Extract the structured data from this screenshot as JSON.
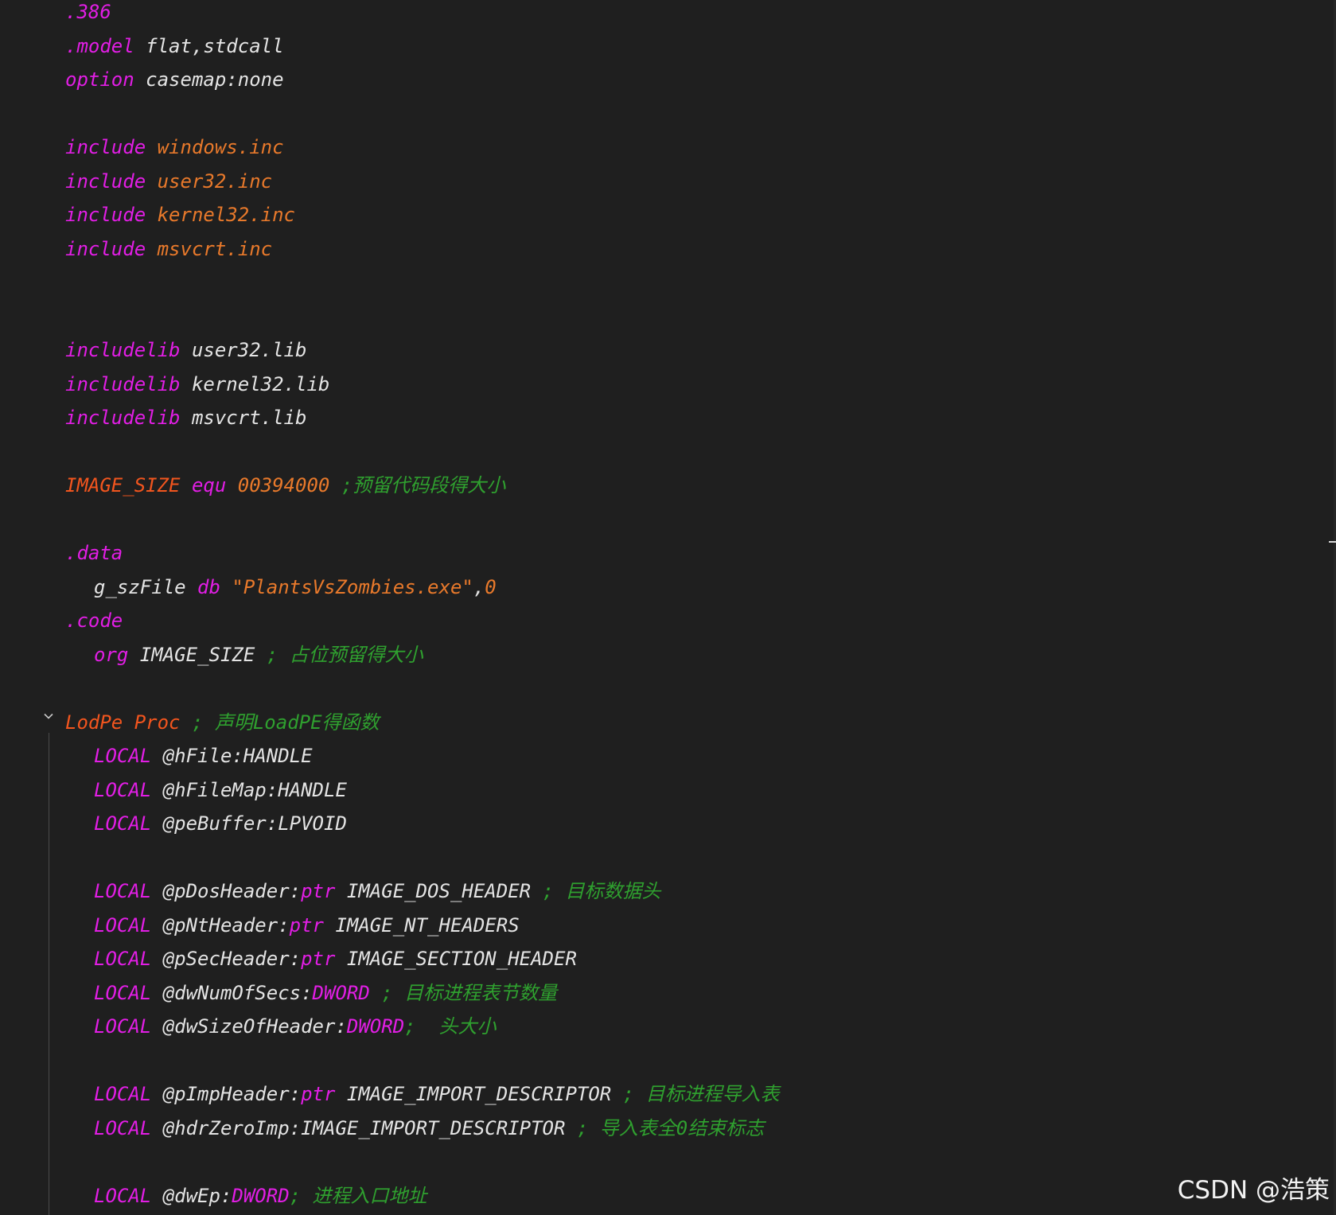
{
  "editor": {
    "colors": {
      "background": "#1f1f1f",
      "keyword": "#e21ee5",
      "string_orange": "#e8792b",
      "identifier_red": "#f2551e",
      "plain": "#e4e4e4",
      "comment": "#2fa02f"
    },
    "lines": [
      {
        "indent": 0,
        "tokens": [
          {
            "t": ".386",
            "c": "kw"
          }
        ]
      },
      {
        "indent": 0,
        "tokens": [
          {
            "t": ".model",
            "c": "kw"
          },
          {
            "t": " flat,stdcall",
            "c": "plain"
          }
        ]
      },
      {
        "indent": 0,
        "tokens": [
          {
            "t": "option",
            "c": "kw"
          },
          {
            "t": " casemap:none",
            "c": "plain"
          }
        ]
      },
      {
        "indent": 0,
        "tokens": []
      },
      {
        "indent": 0,
        "tokens": [
          {
            "t": "include",
            "c": "kw"
          },
          {
            "t": " windows.inc",
            "c": "orange"
          }
        ]
      },
      {
        "indent": 0,
        "tokens": [
          {
            "t": "include",
            "c": "kw"
          },
          {
            "t": " user32.inc",
            "c": "orange"
          }
        ]
      },
      {
        "indent": 0,
        "tokens": [
          {
            "t": "include",
            "c": "kw"
          },
          {
            "t": " kernel32.inc",
            "c": "orange"
          }
        ]
      },
      {
        "indent": 0,
        "tokens": [
          {
            "t": "include",
            "c": "kw"
          },
          {
            "t": " msvcrt.inc",
            "c": "orange"
          }
        ]
      },
      {
        "indent": 0,
        "tokens": []
      },
      {
        "indent": 0,
        "tokens": []
      },
      {
        "indent": 0,
        "tokens": [
          {
            "t": "includelib",
            "c": "kw"
          },
          {
            "t": " user32.lib",
            "c": "plain"
          }
        ]
      },
      {
        "indent": 0,
        "tokens": [
          {
            "t": "includelib",
            "c": "kw"
          },
          {
            "t": " kernel32.lib",
            "c": "plain"
          }
        ]
      },
      {
        "indent": 0,
        "tokens": [
          {
            "t": "includelib",
            "c": "kw"
          },
          {
            "t": " msvcrt.lib",
            "c": "plain"
          }
        ]
      },
      {
        "indent": 0,
        "tokens": []
      },
      {
        "indent": 0,
        "tokens": [
          {
            "t": "IMAGE_SIZE",
            "c": "red"
          },
          {
            "t": " equ",
            "c": "kw"
          },
          {
            "t": " 00394000",
            "c": "orange"
          },
          {
            "t": " ;预留代码段得大小",
            "c": "comment"
          }
        ]
      },
      {
        "indent": 0,
        "tokens": []
      },
      {
        "indent": 0,
        "tokens": [
          {
            "t": ".data",
            "c": "kw"
          }
        ]
      },
      {
        "indent": 1,
        "tokens": [
          {
            "t": "g_szFile",
            "c": "plain"
          },
          {
            "t": " db",
            "c": "kw"
          },
          {
            "t": " \"PlantsVsZombies.exe\"",
            "c": "orange"
          },
          {
            "t": ",",
            "c": "plain"
          },
          {
            "t": "0",
            "c": "orange"
          }
        ]
      },
      {
        "indent": 0,
        "tokens": [
          {
            "t": ".code",
            "c": "kw"
          }
        ]
      },
      {
        "indent": 1,
        "tokens": [
          {
            "t": "org",
            "c": "kw"
          },
          {
            "t": " IMAGE_SIZE",
            "c": "plain"
          },
          {
            "t": " ; 占位预留得大小",
            "c": "comment"
          }
        ]
      },
      {
        "indent": 0,
        "tokens": []
      },
      {
        "indent": 0,
        "tokens": [
          {
            "t": "LodPe",
            "c": "red"
          },
          {
            "t": " Proc",
            "c": "red"
          },
          {
            "t": " ; 声明LoadPE得函数",
            "c": "comment"
          }
        ]
      },
      {
        "indent": 1,
        "tokens": [
          {
            "t": "LOCAL",
            "c": "kw"
          },
          {
            "t": " @hFile:HANDLE",
            "c": "plain"
          }
        ]
      },
      {
        "indent": 1,
        "tokens": [
          {
            "t": "LOCAL",
            "c": "kw"
          },
          {
            "t": " @hFileMap:HANDLE",
            "c": "plain"
          }
        ]
      },
      {
        "indent": 1,
        "tokens": [
          {
            "t": "LOCAL",
            "c": "kw"
          },
          {
            "t": " @peBuffer:LPVOID",
            "c": "plain"
          }
        ]
      },
      {
        "indent": 0,
        "tokens": []
      },
      {
        "indent": 1,
        "tokens": [
          {
            "t": "LOCAL",
            "c": "kw"
          },
          {
            "t": " @pDosHeader:",
            "c": "plain"
          },
          {
            "t": "ptr",
            "c": "kw"
          },
          {
            "t": " IMAGE_DOS_HEADER",
            "c": "plain"
          },
          {
            "t": " ; 目标数据头",
            "c": "comment"
          }
        ]
      },
      {
        "indent": 1,
        "tokens": [
          {
            "t": "LOCAL",
            "c": "kw"
          },
          {
            "t": " @pNtHeader:",
            "c": "plain"
          },
          {
            "t": "ptr",
            "c": "kw"
          },
          {
            "t": " IMAGE_NT_HEADERS",
            "c": "plain"
          }
        ]
      },
      {
        "indent": 1,
        "tokens": [
          {
            "t": "LOCAL",
            "c": "kw"
          },
          {
            "t": " @pSecHeader:",
            "c": "plain"
          },
          {
            "t": "ptr",
            "c": "kw"
          },
          {
            "t": " IMAGE_SECTION_HEADER",
            "c": "plain"
          }
        ]
      },
      {
        "indent": 1,
        "tokens": [
          {
            "t": "LOCAL",
            "c": "kw"
          },
          {
            "t": " @dwNumOfSecs:",
            "c": "plain"
          },
          {
            "t": "DWORD",
            "c": "kw"
          },
          {
            "t": " ; 目标进程表节数量",
            "c": "comment"
          }
        ]
      },
      {
        "indent": 1,
        "tokens": [
          {
            "t": "LOCAL",
            "c": "kw"
          },
          {
            "t": " @dwSizeOfHeader:",
            "c": "plain"
          },
          {
            "t": "DWORD",
            "c": "kw"
          },
          {
            "t": ";  头大小",
            "c": "comment"
          }
        ]
      },
      {
        "indent": 0,
        "tokens": []
      },
      {
        "indent": 1,
        "tokens": [
          {
            "t": "LOCAL",
            "c": "kw"
          },
          {
            "t": " @pImpHeader:",
            "c": "plain"
          },
          {
            "t": "ptr",
            "c": "kw"
          },
          {
            "t": " IMAGE_IMPORT_DESCRIPTOR",
            "c": "plain"
          },
          {
            "t": " ; 目标进程导入表",
            "c": "comment"
          }
        ]
      },
      {
        "indent": 1,
        "tokens": [
          {
            "t": "LOCAL",
            "c": "kw"
          },
          {
            "t": " @hdrZeroImp:IMAGE_IMPORT_DESCRIPTOR",
            "c": "plain"
          },
          {
            "t": " ; 导入表全0结束标志",
            "c": "comment"
          }
        ]
      },
      {
        "indent": 0,
        "tokens": []
      },
      {
        "indent": 1,
        "tokens": [
          {
            "t": "LOCAL",
            "c": "kw"
          },
          {
            "t": " @dwEp:",
            "c": "plain"
          },
          {
            "t": "DWORD",
            "c": "kw"
          },
          {
            "t": "; 进程入口地址",
            "c": "comment"
          }
        ]
      }
    ],
    "fold_icon": "chevron-down-icon",
    "watermark": "CSDN @浩策"
  }
}
